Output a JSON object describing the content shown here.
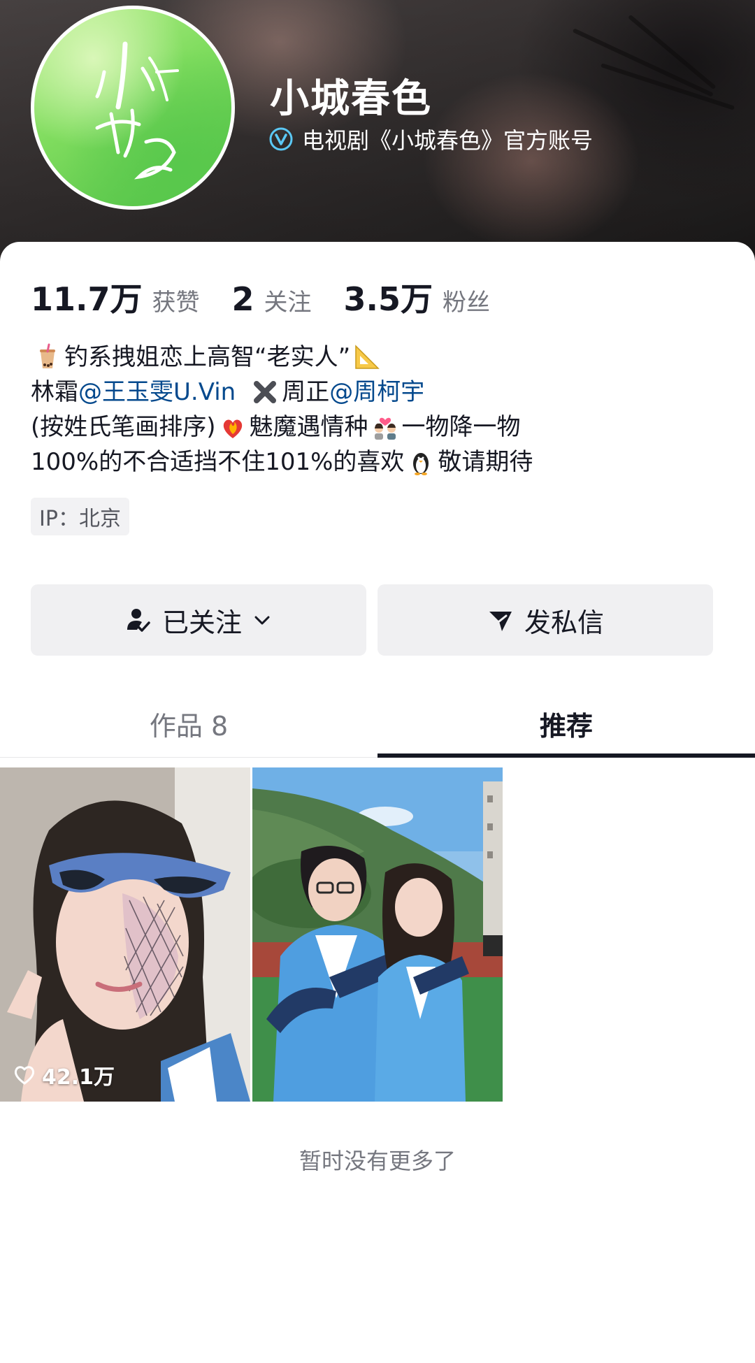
{
  "header": {
    "name": "小城春色",
    "verify_label": "电视剧《小城春色》官方账号",
    "avatar_calligraphy": "小城春色"
  },
  "stats": [
    {
      "value": "11.7万",
      "label": "获赞"
    },
    {
      "value": "2",
      "label": "关注"
    },
    {
      "value": "3.5万",
      "label": "粉丝"
    }
  ],
  "bio": {
    "line1": {
      "text_a": "钓系拽姐恋上高智“老实人”",
      "emoji_start": "bubble-tea-icon",
      "emoji_end": "triangular-ruler-icon"
    },
    "line2": {
      "text_a": "林霜",
      "mention_a": "@王玉雯U.Vin",
      "emoji_mid": "cross-mark-icon",
      "text_b": "周正",
      "mention_b": "@周柯宇"
    },
    "line3": {
      "text_a": "(按姓氏笔画排序)",
      "emoji_a": "heart-on-fire-icon",
      "text_b": "魅魔遇情种",
      "emoji_b": "couple-with-heart-icon",
      "text_c": "一物降一物"
    },
    "line4": {
      "text_a": "100%的不合适挡不住101%的喜欢",
      "emoji_a": "penguin-icon",
      "text_b": "敬请期待"
    }
  },
  "ip_tag": "IP：北京",
  "actions": {
    "follow_label": "已关注",
    "message_label": "发私信"
  },
  "tabs": [
    {
      "label": "作品 8",
      "active": false
    },
    {
      "label": "推荐",
      "active": true
    }
  ],
  "videos": [
    {
      "likes": "42.1万"
    },
    {
      "likes": ""
    }
  ],
  "footer_text": "暂时没有更多了",
  "colors": {
    "mention": "#04498d",
    "primary_text": "#161823",
    "secondary_text": "#75777f",
    "button_bg": "#f0f0f2"
  }
}
